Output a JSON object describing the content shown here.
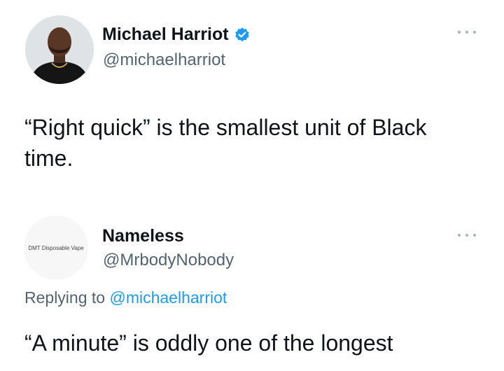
{
  "tweets": [
    {
      "author": {
        "display_name": "Michael Harriot",
        "handle": "@michaelharriot",
        "verified": true,
        "avatar": "profile-photo"
      },
      "text": "“Right quick” is the smallest unit of Black time.",
      "more_icon": "more-icon"
    },
    {
      "author": {
        "display_name": "Nameless",
        "handle": "@MrbodyNobody",
        "verified": false,
        "avatar_caption": "DMT Disposable Vape"
      },
      "replying": {
        "prefix": "Replying to",
        "mention": "@michaelharriot"
      },
      "text": "“A minute” is oddly one of the longest",
      "more_icon": "more-icon"
    }
  ],
  "colors": {
    "text": "#0f1419",
    "secondary": "#536471",
    "link": "#1d9bf0",
    "verified_badge": "#1d9bf0"
  }
}
